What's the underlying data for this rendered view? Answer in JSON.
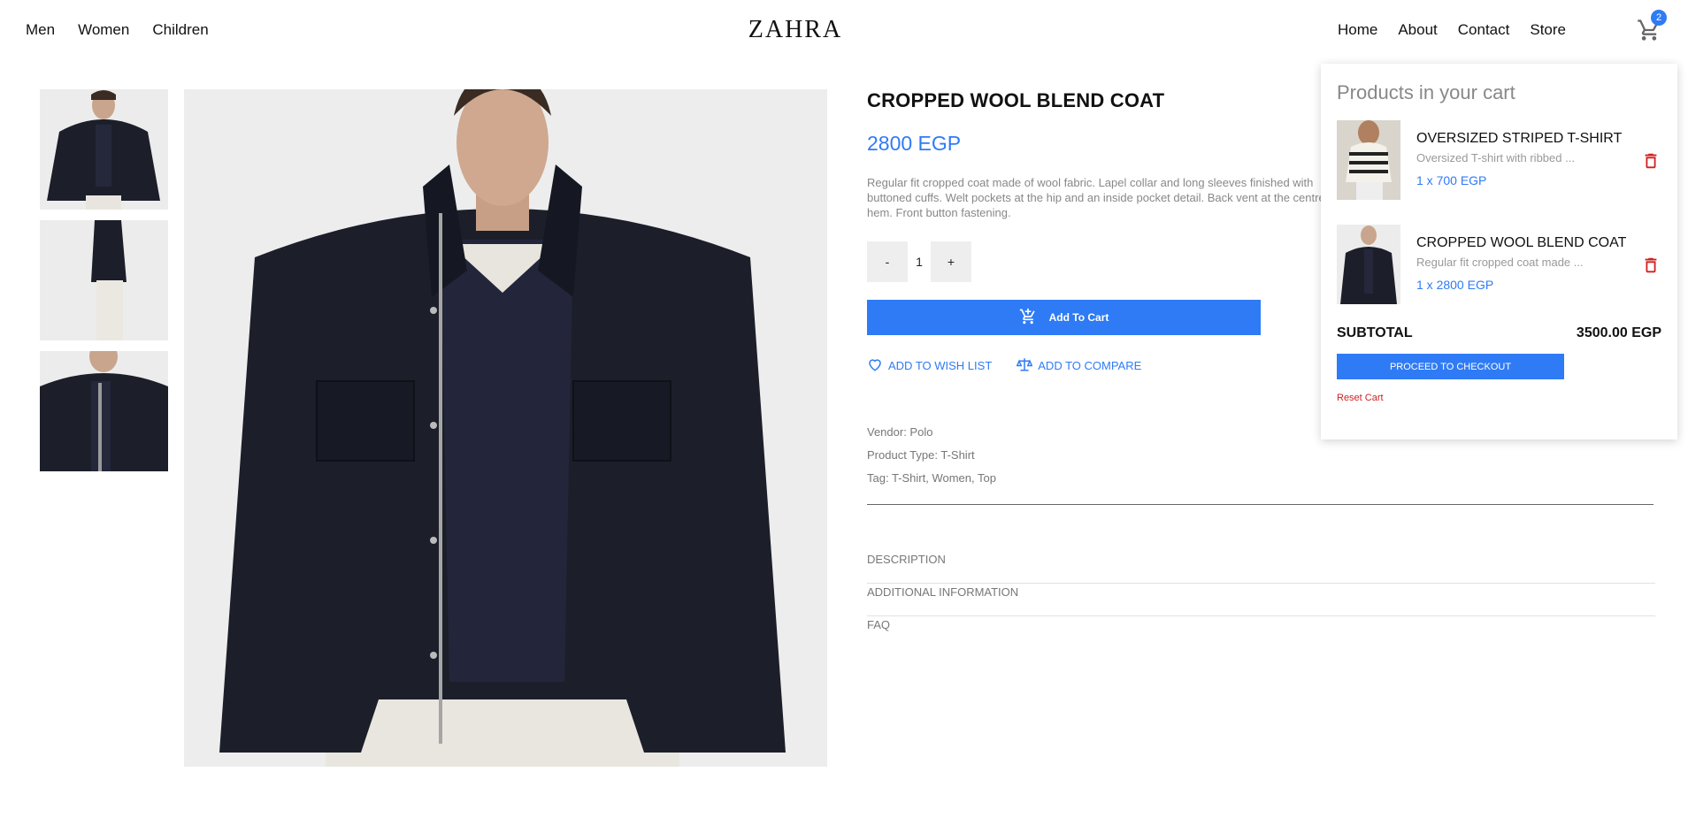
{
  "header": {
    "nav_left": [
      "Men",
      "Women",
      "Children"
    ],
    "logo": "ZAHRA",
    "nav_right": [
      "Home",
      "About",
      "Contact",
      "Store"
    ],
    "cart_count": "2"
  },
  "product": {
    "title": "CROPPED WOOL BLEND COAT",
    "price": "2800 EGP",
    "description": "Regular fit cropped coat made of wool fabric. Lapel collar and long sleeves finished with buttoned cuffs. Welt pockets at the hip and an inside pocket detail. Back vent at the centre hem. Front button fastening.",
    "quantity": {
      "minus": "-",
      "value": "1",
      "plus": "+"
    },
    "add_to_cart": "Add To Cart",
    "wishlist": "ADD TO WISH LIST",
    "compare": "ADD TO COMPARE",
    "meta": {
      "vendor": "Vendor: Polo",
      "type": "Product Type: T-Shirt",
      "tags": "Tag: T-Shirt, Women, Top"
    },
    "accordion": [
      "DESCRIPTION",
      "ADDITIONAL INFORMATION",
      "FAQ"
    ]
  },
  "cart": {
    "title": "Products in your cart",
    "items": [
      {
        "name": "OVERSIZED STRIPED T-SHIRT",
        "desc": "Oversized T-shirt with ribbed ...",
        "qty": "1 x 700 EGP"
      },
      {
        "name": "CROPPED WOOL BLEND COAT",
        "desc": "Regular fit cropped coat made ...",
        "qty": "1 x 2800 EGP"
      }
    ],
    "subtotal_label": "SUBTOTAL",
    "subtotal_value": "3500.00 EGP",
    "checkout": "PROCEED TO CHECKOUT",
    "reset": "Reset Cart"
  },
  "colors": {
    "accent": "#2f7bf5",
    "danger": "#d21f1f",
    "coat": "#1c1f2a",
    "background": "#ffffff"
  },
  "icons": [
    "shopping-cart-icon",
    "add-to-cart-icon",
    "heart-icon",
    "scale-icon",
    "trash-icon"
  ]
}
